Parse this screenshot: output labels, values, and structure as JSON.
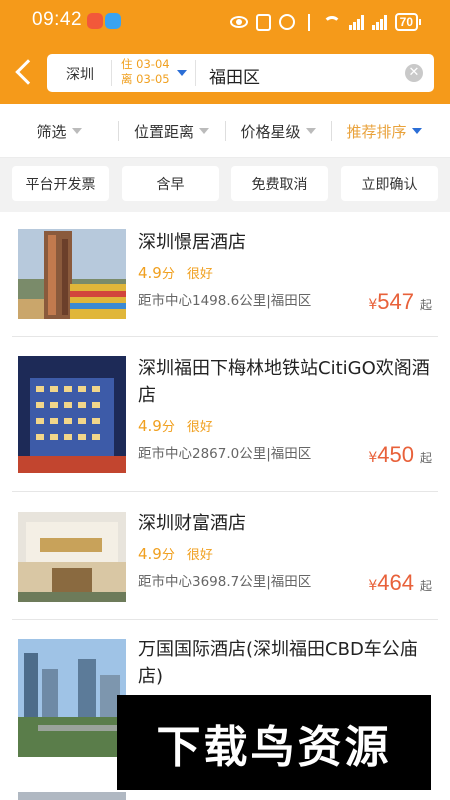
{
  "status_bar": {
    "time": "09:42",
    "battery": "70"
  },
  "search": {
    "city": "深圳",
    "checkin_label": "住",
    "checkin_date": "03-04",
    "checkout_label": "离",
    "checkout_date": "03-05",
    "district": "福田区"
  },
  "filters": [
    {
      "label": "筛选",
      "active": false
    },
    {
      "label": "位置距离",
      "active": false
    },
    {
      "label": "价格星级",
      "active": false
    },
    {
      "label": "推荐排序",
      "active": true
    }
  ],
  "chips": [
    "平台开发票",
    "含早",
    "免费取消",
    "立即确认"
  ],
  "hotels": [
    {
      "name": "深圳憬居酒店",
      "score": "4.9",
      "score_unit": "分",
      "rating_text": "很好",
      "distance": "距市中心1498.6公里|福田区",
      "currency": "¥",
      "price": "547",
      "price_suffix": "起"
    },
    {
      "name": "深圳福田下梅林地铁站CitiGO欢阁酒店",
      "score": "4.9",
      "score_unit": "分",
      "rating_text": "很好",
      "distance": "距市中心2867.0公里|福田区",
      "currency": "¥",
      "price": "450",
      "price_suffix": "起"
    },
    {
      "name": "深圳财富酒店",
      "score": "4.9",
      "score_unit": "分",
      "rating_text": "很好",
      "distance": "距市中心3698.7公里|福田区",
      "currency": "¥",
      "price": "464",
      "price_suffix": "起"
    },
    {
      "name": "万国国际酒店(深圳福田CBD车公庙店)"
    }
  ],
  "watermark": "下载鸟资源",
  "colors": {
    "header": "#f59a1a",
    "accent": "#f0a020",
    "price": "#e8613a",
    "active_caret": "#2b6ed6"
  }
}
